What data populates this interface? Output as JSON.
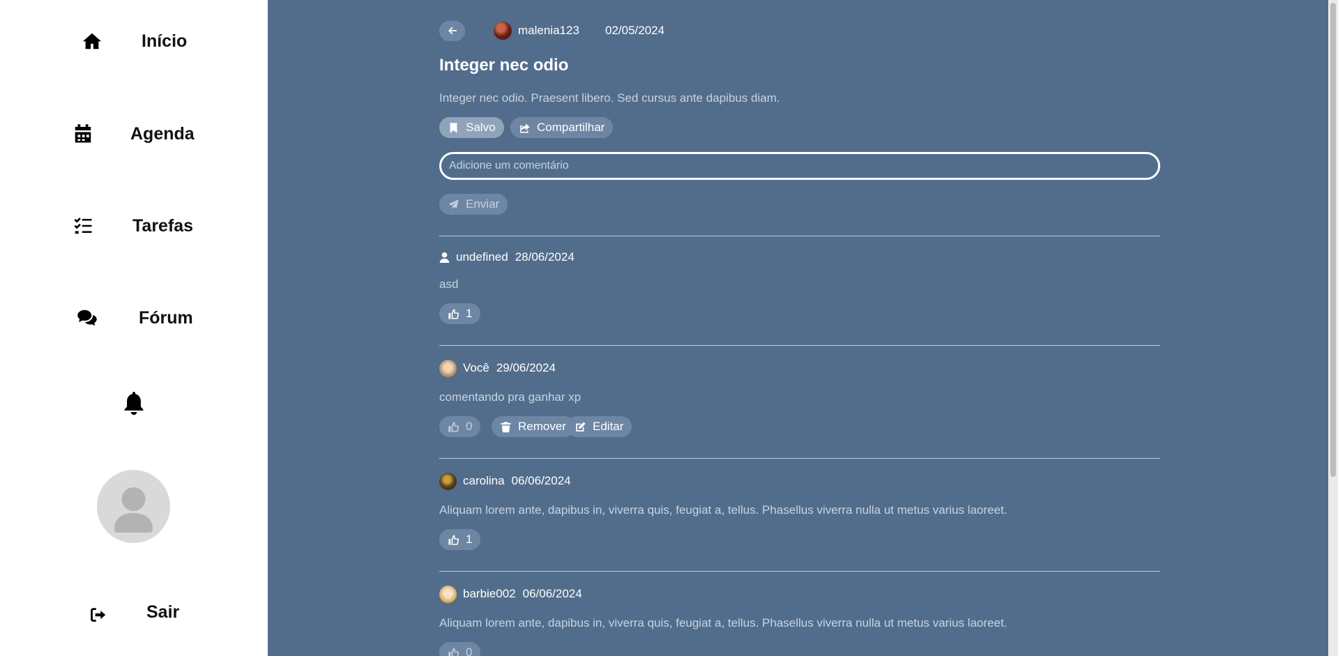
{
  "sidebar": {
    "items": [
      {
        "label": "Início",
        "icon": "home-icon"
      },
      {
        "label": "Agenda",
        "icon": "calendar-icon"
      },
      {
        "label": "Tarefas",
        "icon": "task-list-icon"
      },
      {
        "label": "Fórum",
        "icon": "comments-icon"
      }
    ],
    "notifications_icon": "bell-icon",
    "profile_icon": "user-avatar-icon",
    "logout": {
      "label": "Sair",
      "icon": "sign-out-icon"
    }
  },
  "post": {
    "author": "malenia123",
    "date": "02/05/2024",
    "title": "Integer nec odio",
    "body": "Integer nec odio. Praesent libero. Sed cursus ante dapibus diam.",
    "saved_label": "Salvo",
    "share_label": "Compartilhar"
  },
  "comment_form": {
    "placeholder": "Adicione um comentário",
    "send_label": "Enviar"
  },
  "comments": [
    {
      "user": "undefined",
      "date": "28/06/2024",
      "text": "asd",
      "likes": "1"
    },
    {
      "user": "Você",
      "date": "29/06/2024",
      "text": "comentando pra ganhar xp",
      "likes": "0",
      "remove_label": "Remover",
      "edit_label": "Editar"
    },
    {
      "user": "carolina",
      "date": "06/06/2024",
      "text": "Aliquam lorem ante, dapibus in, viverra quis, feugiat a, tellus. Phasellus viverra nulla ut metus varius laoreet.",
      "likes": "1"
    },
    {
      "user": "barbie002",
      "date": "06/06/2024",
      "text": "Aliquam lorem ante, dapibus in, viverra quis, feugiat a, tellus. Phasellus viverra nulla ut metus varius laoreet.",
      "likes": "0"
    }
  ],
  "colors": {
    "background": "#526d8c",
    "sidebar": "#ffffff",
    "pill": "#6d86a3",
    "pill_saved": "#8fa3ba",
    "muted_text": "#c7d3e2"
  }
}
